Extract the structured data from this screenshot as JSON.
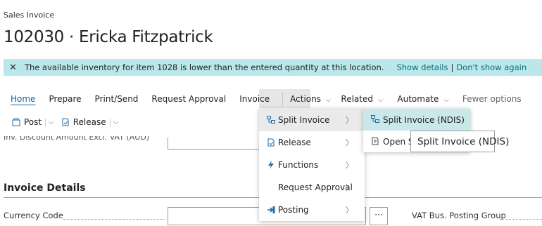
{
  "header": {
    "breadcrumb": "Sales Invoice",
    "title": "102030 · Ericka Fitzpatrick"
  },
  "notification": {
    "close_icon": "close-icon",
    "message": "The available inventory for item 1028 is lower than the entered quantity at this location.",
    "show_details": "Show details",
    "separator": "|",
    "dont_show": "Don't show again"
  },
  "actionbar": {
    "home": "Home",
    "prepare": "Prepare",
    "print_send": "Print/Send",
    "request_approval": "Request Approval",
    "invoice": "Invoice",
    "actions": "Actions",
    "related": "Related",
    "automate": "Automate",
    "fewer_options": "Fewer options"
  },
  "toolbar": {
    "post": "Post",
    "release": "Release"
  },
  "form": {
    "cut_field_label": "Inv. Discount Amount Excl. VAT (AUD)",
    "section": "Invoice Details",
    "currency_code_label": "Currency Code",
    "currency_lookup": "···",
    "vat_label": "VAT Bus. Posting Group"
  },
  "actions_menu": {
    "items": [
      {
        "label": "Split Invoice",
        "icon": "split-invoice-icon"
      },
      {
        "label": "Release",
        "icon": "release-icon"
      },
      {
        "label": "Functions",
        "icon": "lightning-icon"
      },
      {
        "label": "Request Approval",
        "icon": ""
      },
      {
        "label": "Posting",
        "icon": "posting-icon"
      }
    ]
  },
  "submenu": {
    "items": [
      {
        "label": "Split Invoice (NDIS)",
        "icon": "split-invoice-icon"
      },
      {
        "label": "Open S",
        "icon": "document-icon"
      }
    ]
  },
  "tooltip": {
    "text": "Split Invoice (NDIS)"
  },
  "colors": {
    "banner": "#b9e7ea",
    "link": "#0a6f7a",
    "accent": "#1264a3",
    "highlight": "#c9e8ea"
  }
}
